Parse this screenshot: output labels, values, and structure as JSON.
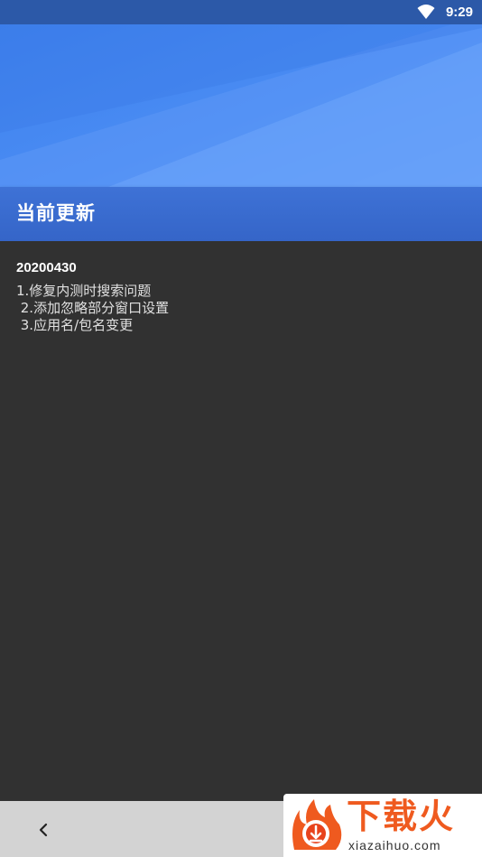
{
  "status_bar": {
    "time": "9:29",
    "wifi_icon": "wifi-icon"
  },
  "header": {
    "title": "当前更新"
  },
  "content": {
    "version": "20200430",
    "notes": "1.修复内测时搜索问题\n 2.添加忽略部分窗口设置\n 3.应用名/包名变更"
  },
  "nav": {
    "back_icon": "chevron-left-icon"
  },
  "watermark": {
    "brand": "下载火",
    "url": "xiazaihuo.com"
  },
  "colors": {
    "status_bar": "#2c59a8",
    "header": "#4a8cf3",
    "title_band": "#3565c8",
    "content_bg": "#313131",
    "nav_bg": "#d3d3d3",
    "brand_orange": "#ef5a1f"
  }
}
